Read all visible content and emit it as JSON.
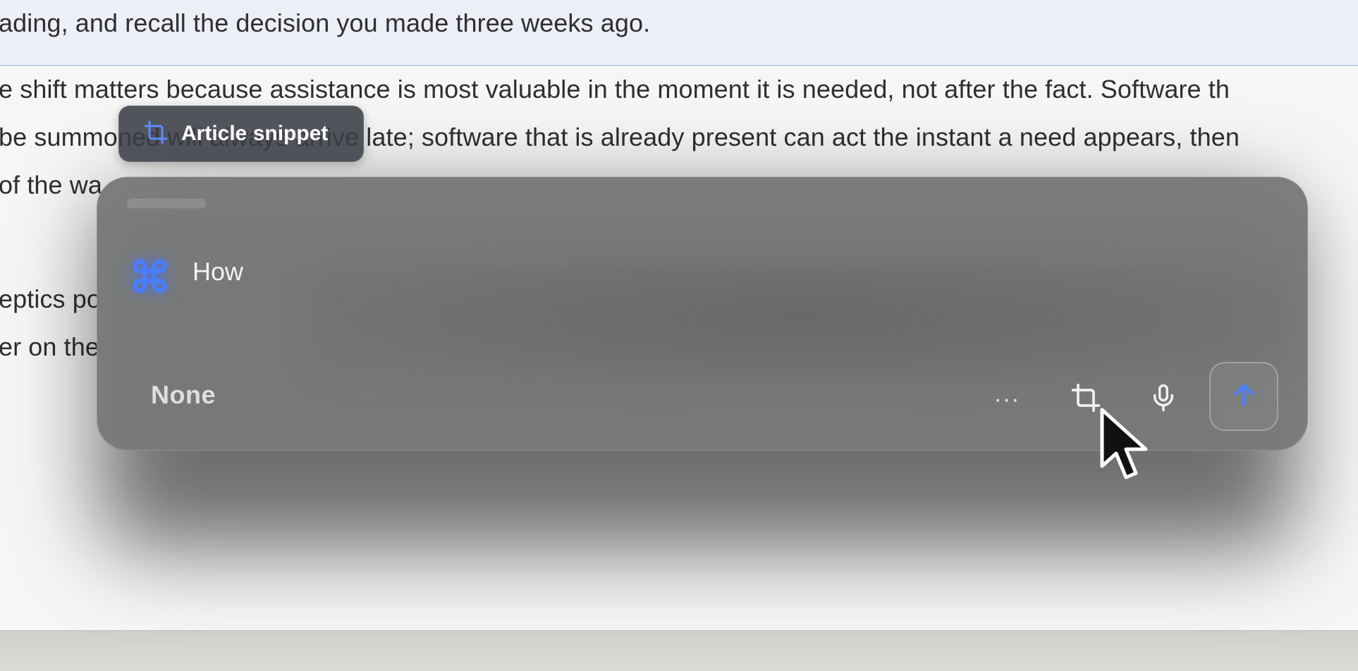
{
  "document": {
    "lines": [
      "ading, and recall the decision you made three weeks ago.",
      "e shift matters because assistance is most valuable in the moment it is needed, not after the fact. Software th",
      "be summoned will always arrive late; software that is already present can act the instant a need appears, then",
      "of the wa",
      "eptics po",
      "er on the"
    ]
  },
  "chip": {
    "label": "Article snippet",
    "icon": "crop-icon"
  },
  "panel": {
    "query": "How",
    "model": "None",
    "app_icon": "command-icon",
    "accent_color": "#3a6ff7",
    "tools": {
      "more": "···",
      "crop_icon": "crop-icon",
      "mic_icon": "microphone-icon",
      "send_icon": "arrow-up-icon"
    }
  }
}
